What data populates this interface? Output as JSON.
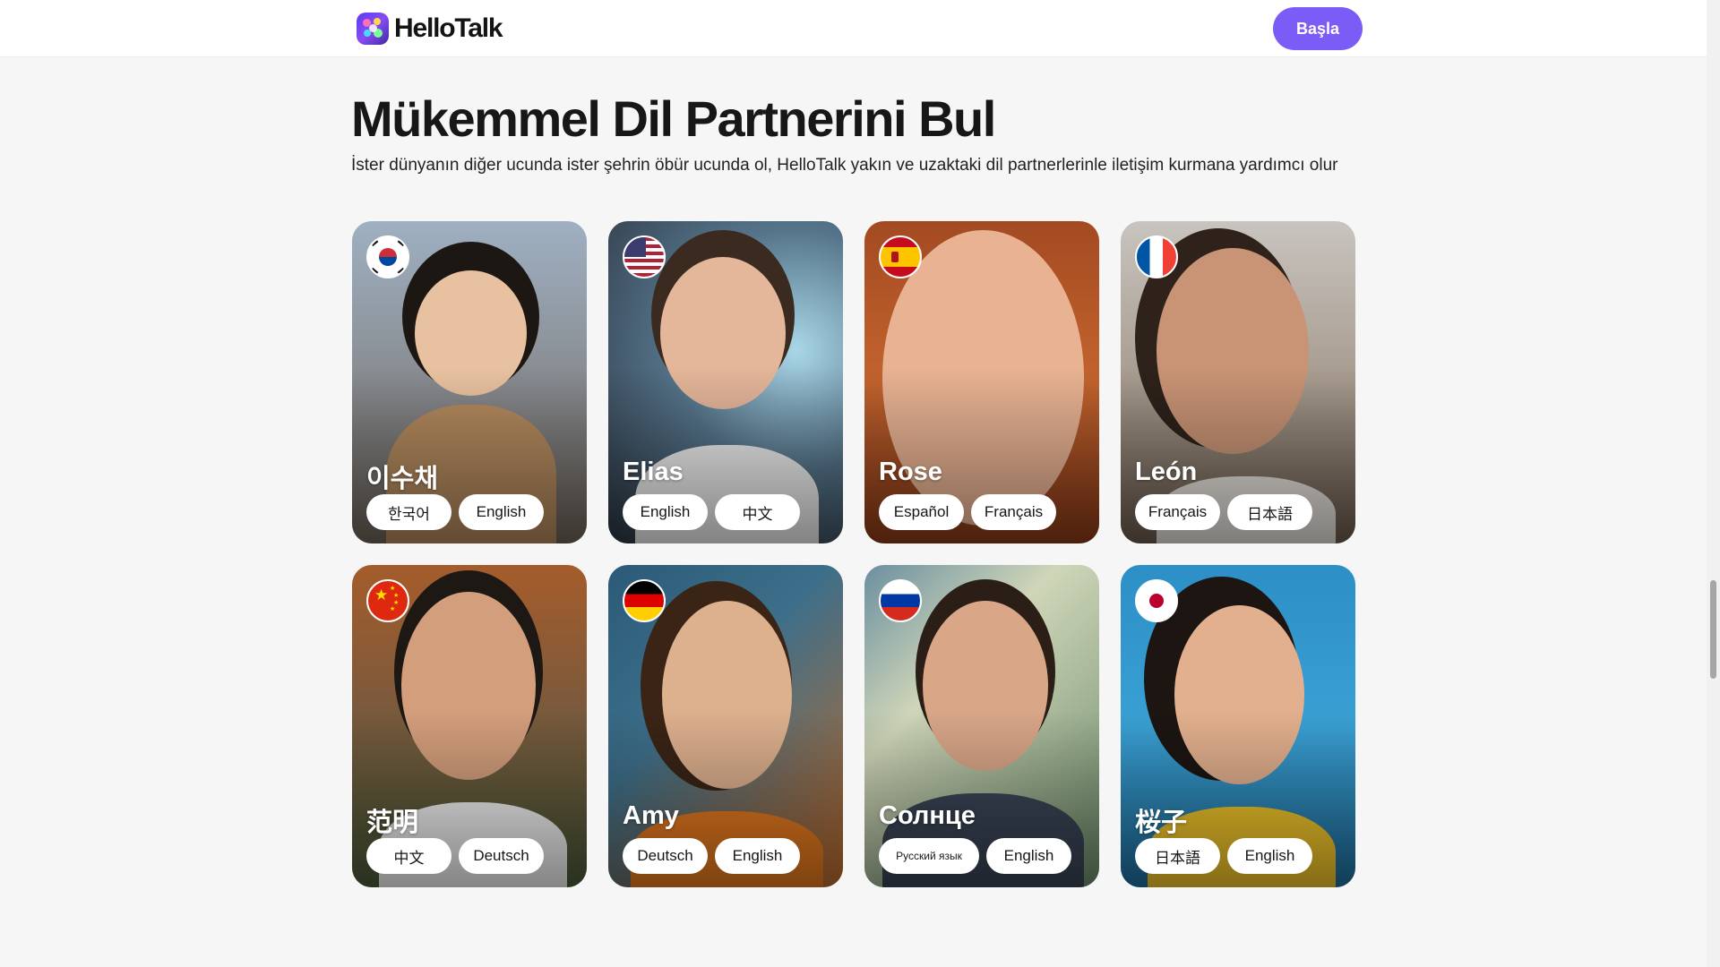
{
  "header": {
    "logo_text": "HelloTalk",
    "cta_label": "Başla",
    "accent_color": "#7c5cf6"
  },
  "section": {
    "title": "Mükemmel Dil Partnerini Bul",
    "subtitle": "İster dünyanın diğer ucunda ister şehrin öbür ucunda ol, HelloTalk yakın ve uzaktaki dil partnerlerinle iletişim kurmana yardımcı olur"
  },
  "cards": [
    {
      "name": "이수채",
      "flag": "south-korea-flag",
      "languages": [
        "한국어",
        "English"
      ]
    },
    {
      "name": "Elias",
      "flag": "united-states-flag",
      "languages": [
        "English",
        "中文"
      ]
    },
    {
      "name": "Rose",
      "flag": "spain-flag",
      "languages": [
        "Español",
        "Français"
      ]
    },
    {
      "name": "León",
      "flag": "france-flag",
      "languages": [
        "Français",
        "日本語"
      ]
    },
    {
      "name": "范明",
      "flag": "china-flag",
      "languages": [
        "中文",
        "Deutsch"
      ]
    },
    {
      "name": "Amy",
      "flag": "germany-flag",
      "languages": [
        "Deutsch",
        "English"
      ]
    },
    {
      "name": "Солнце",
      "flag": "russia-flag",
      "languages": [
        "Русский язык",
        "English"
      ]
    },
    {
      "name": "桜子",
      "flag": "japan-flag",
      "languages": [
        "日本語",
        "English"
      ]
    }
  ]
}
